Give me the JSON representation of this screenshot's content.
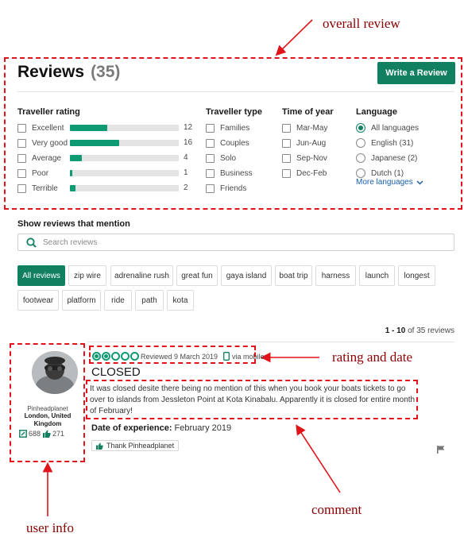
{
  "annotations": {
    "overall_review": "overall review",
    "rating_and_date": "rating and date",
    "comment": "comment",
    "user_info": "user info"
  },
  "header": {
    "title": "Reviews",
    "count": "(35)",
    "write_label": "Write a Review"
  },
  "filters": {
    "traveller_rating": {
      "title": "Traveller rating",
      "items": [
        {
          "label": "Excellent",
          "count": "12",
          "fraction": 0.34
        },
        {
          "label": "Very good",
          "count": "16",
          "fraction": 0.45
        },
        {
          "label": "Average",
          "count": "4",
          "fraction": 0.11
        },
        {
          "label": "Poor",
          "count": "1",
          "fraction": 0.02
        },
        {
          "label": "Terrible",
          "count": "2",
          "fraction": 0.05
        }
      ]
    },
    "traveller_type": {
      "title": "Traveller type",
      "items": [
        "Families",
        "Couples",
        "Solo",
        "Business",
        "Friends"
      ]
    },
    "time_of_year": {
      "title": "Time of year",
      "items": [
        "Mar-May",
        "Jun-Aug",
        "Sep-Nov",
        "Dec-Feb"
      ]
    },
    "language": {
      "title": "Language",
      "items": [
        "All languages",
        "English (31)",
        "Japanese (2)",
        "Dutch (1)"
      ],
      "selected": "All languages",
      "more": "More languages"
    }
  },
  "mentions": {
    "title": "Show reviews that mention",
    "search_placeholder": "Search reviews",
    "chips": [
      "All reviews",
      "zip wire",
      "adrenaline rush",
      "great fun",
      "gaya island",
      "boat trip",
      "harness",
      "launch",
      "longest",
      "footwear",
      "platform",
      "ride",
      "path",
      "kota"
    ],
    "active": "All reviews"
  },
  "pagination": {
    "range": "1 - 10",
    "suffix": "of 35 reviews"
  },
  "review": {
    "user": {
      "name": "Pinheadplanet",
      "location": "London, United Kingdom",
      "contributions": "688",
      "helpful": "271"
    },
    "rating": 2,
    "rating_max": 5,
    "reviewed": "Reviewed 9 March 2019",
    "via": "via mobile",
    "title": "CLOSED",
    "text": "It was closed desite there being no mention of this when you book your boats tickets to go over to islands from Jessleton Point at Kota Kinabalu. Apparently it is closed for entire month of February!",
    "doe_label": "Date of experience:",
    "doe_value": "February 2019",
    "thank_label": "Thank Pinheadplanet"
  },
  "colors": {
    "accent": "#118061",
    "bar": "#0e9a72",
    "annotation_box": "#e0141a",
    "annotation_text": "#8b0000"
  },
  "icons": [
    "search-icon",
    "chevron-down-icon",
    "mobile-icon",
    "review-count-icon",
    "thumbs-up-icon",
    "flag-icon",
    "annotation-arrow-icon"
  ]
}
